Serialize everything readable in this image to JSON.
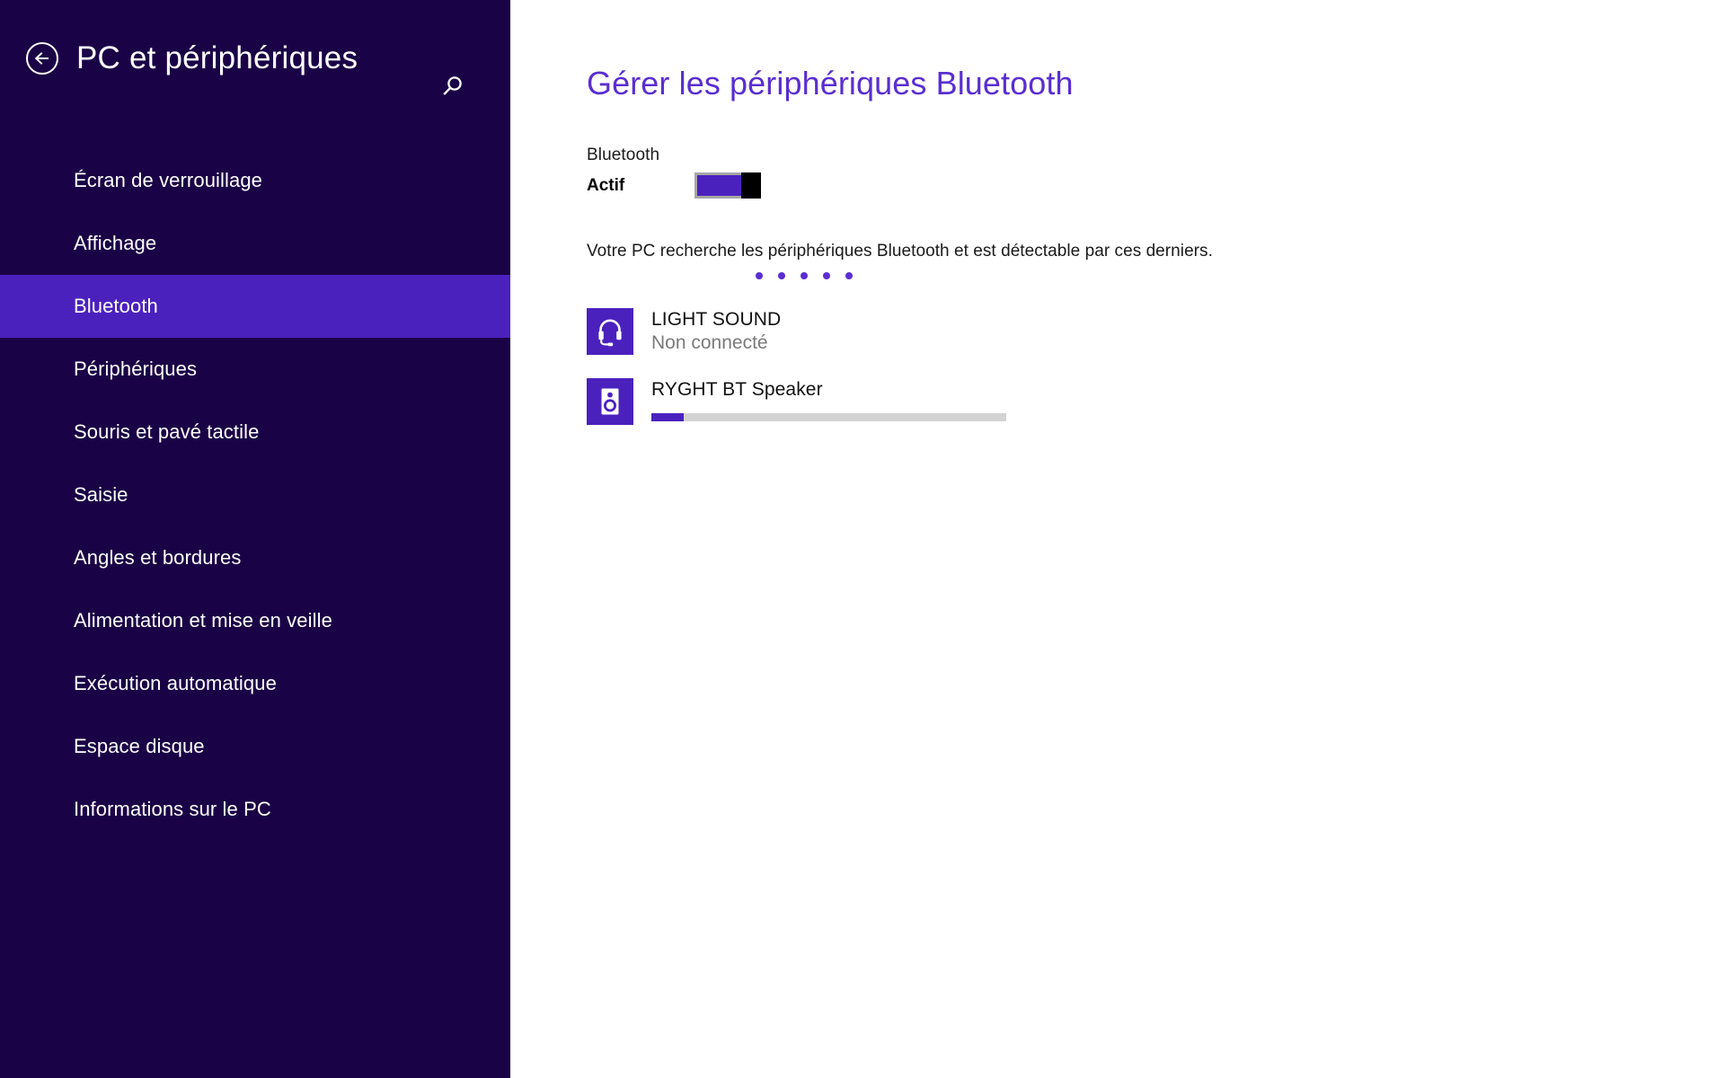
{
  "sidebar": {
    "back_icon": "back-arrow-circle-icon",
    "title": "PC et périphériques",
    "search_icon": "search-icon",
    "items": [
      {
        "label": "Écran de verrouillage",
        "selected": false
      },
      {
        "label": "Affichage",
        "selected": false
      },
      {
        "label": "Bluetooth",
        "selected": true
      },
      {
        "label": "Périphériques",
        "selected": false
      },
      {
        "label": "Souris et pavé tactile",
        "selected": false
      },
      {
        "label": "Saisie",
        "selected": false
      },
      {
        "label": "Angles et bordures",
        "selected": false
      },
      {
        "label": "Alimentation et mise en veille",
        "selected": false
      },
      {
        "label": "Exécution automatique",
        "selected": false
      },
      {
        "label": "Espace disque",
        "selected": false
      },
      {
        "label": "Informations sur le PC",
        "selected": false
      }
    ]
  },
  "main": {
    "title": "Gérer les périphériques Bluetooth",
    "toggle": {
      "caption": "Bluetooth",
      "state_label": "Actif",
      "on": true
    },
    "status_text": "Votre PC recherche les périphériques Bluetooth et est détectable par ces derniers.",
    "loading_dots": 5,
    "devices": [
      {
        "name": "LIGHT SOUND",
        "status": "Non connecté",
        "icon": "headset-icon",
        "progress": null
      },
      {
        "name": "RYGHT BT Speaker",
        "status": "",
        "icon": "speaker-icon",
        "progress": 9
      }
    ]
  },
  "colors": {
    "sidebar_bg": "#1a0246",
    "accent": "#4b21be",
    "title_purple": "#5a2ed0",
    "content_bg": "#ffffff",
    "muted_text": "#7a7a7a",
    "progress_track": "#d3d3d3"
  }
}
